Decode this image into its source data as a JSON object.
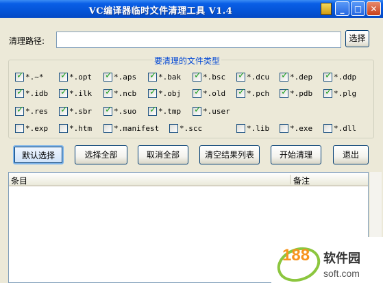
{
  "window": {
    "title": "VC编译器临时文件清理工具 V1.4"
  },
  "path": {
    "label": "清理路径:",
    "value": "",
    "select_button": "选择"
  },
  "filetypes": {
    "group_title": "要清理的文件类型",
    "items": [
      {
        "label": "*.~*",
        "checked": true
      },
      {
        "label": "*.opt",
        "checked": true
      },
      {
        "label": "*.aps",
        "checked": true
      },
      {
        "label": "*.bak",
        "checked": true
      },
      {
        "label": "*.bsc",
        "checked": true
      },
      {
        "label": "*.dcu",
        "checked": true
      },
      {
        "label": "*.dep",
        "checked": true
      },
      {
        "label": "*.ddp",
        "checked": true
      },
      {
        "label": "*.idb",
        "checked": true
      },
      {
        "label": "*.ilk",
        "checked": true
      },
      {
        "label": "*.ncb",
        "checked": true
      },
      {
        "label": "*.obj",
        "checked": true
      },
      {
        "label": "*.old",
        "checked": true
      },
      {
        "label": "*.pch",
        "checked": true
      },
      {
        "label": "*.pdb",
        "checked": true
      },
      {
        "label": "*.plg",
        "checked": true
      },
      {
        "label": "*.res",
        "checked": true
      },
      {
        "label": "*.sbr",
        "checked": true
      },
      {
        "label": "*.suo",
        "checked": true
      },
      {
        "label": "*.tmp",
        "checked": true
      },
      {
        "label": "*.user",
        "checked": true
      },
      {
        "label": "*.exp",
        "checked": false
      },
      {
        "label": "*.htm",
        "checked": false
      },
      {
        "label": "*.manifest",
        "checked": false
      },
      {
        "label": "*.scc",
        "checked": false
      },
      {
        "label": "*.lib",
        "checked": false
      },
      {
        "label": "*.exe",
        "checked": false
      },
      {
        "label": "*.dll",
        "checked": false
      }
    ]
  },
  "actions": {
    "default": "默认选择",
    "select_all": "选择全部",
    "cancel_all": "取消全部",
    "clear_list": "清空结果列表",
    "start": "开始清理",
    "exit": "退出"
  },
  "results": {
    "columns": [
      "条目",
      "备注"
    ],
    "rows": []
  },
  "watermark": {
    "number": "188",
    "cn": "软件园",
    "domain": "soft.com"
  },
  "colors": {
    "titlebar": "#0454d8",
    "checkmark": "#21a121",
    "group_title": "#0046d5"
  }
}
